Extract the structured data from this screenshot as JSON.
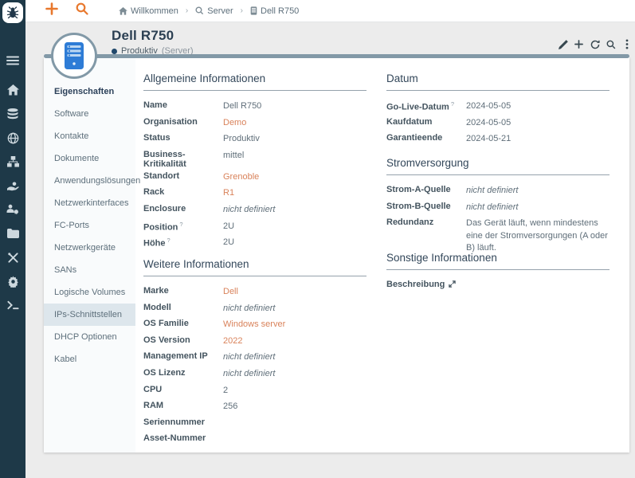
{
  "app": {
    "accent_orange": "#e8782d",
    "link_orange": "#d9825a",
    "sidebar_color": "#1e3948",
    "bar_color": "#8299a7"
  },
  "sidebar": {
    "icons": [
      "bug-logo",
      "hamburger-menu",
      "home",
      "database",
      "globe",
      "sitemap",
      "hand-service",
      "team-settings",
      "folder",
      "tools",
      "gear",
      "terminal"
    ]
  },
  "topbar": {
    "separator": "›",
    "breadcrumb": [
      {
        "label": "Willkommen",
        "icon": "home-icon"
      },
      {
        "label": "Server",
        "icon": "search-icon"
      },
      {
        "label": "Dell R750",
        "icon": "server-icon"
      }
    ]
  },
  "header": {
    "title": "Dell R750",
    "status": "Produktiv",
    "type_label": "(Server)",
    "actions": [
      "edit",
      "add",
      "refresh",
      "search",
      "more"
    ]
  },
  "menu": {
    "items": [
      "Eigenschaften",
      "Software",
      "Kontakte",
      "Dokumente",
      "Anwendungslösungen",
      "Netzwerkinterfaces",
      "FC-Ports",
      "Netzwerkgeräte",
      "SANs",
      "Logische Volumes",
      "IPs-Schnittstellen",
      "DHCP Optionen",
      "Kabel"
    ],
    "active_item": "Eigenschaften",
    "highlighted_item": "IPs-Schnittstellen"
  },
  "sections": {
    "allgemeine": {
      "title": "Allgemeine Informationen",
      "fields": [
        {
          "label": "Name",
          "value": "Dell R750"
        },
        {
          "label": "Organisation",
          "value": "Demo"
        },
        {
          "label": "Status",
          "value": "Produktiv"
        },
        {
          "label": "Business-Kritikalität",
          "value": "mittel"
        },
        {
          "label": "Standort",
          "value": "Grenoble"
        },
        {
          "label": "Rack",
          "value": "R1"
        },
        {
          "label": "Enclosure",
          "value": "nicht definiert"
        },
        {
          "label": "Position",
          "hint": "?",
          "value": "2U"
        },
        {
          "label": "Höhe",
          "hint": "?",
          "value": "2U"
        }
      ]
    },
    "weitere": {
      "title": "Weitere Informationen",
      "fields": [
        {
          "label": "Marke",
          "value": "Dell"
        },
        {
          "label": "Modell",
          "value": "nicht definiert"
        },
        {
          "label": "OS Familie",
          "value": "Windows server"
        },
        {
          "label": "OS Version",
          "value": "2022"
        },
        {
          "label": "Management IP",
          "value": "nicht definiert"
        },
        {
          "label": "OS Lizenz",
          "value": "nicht definiert"
        },
        {
          "label": "CPU",
          "value": "2"
        },
        {
          "label": "RAM",
          "value": "256"
        },
        {
          "label": "Seriennummer",
          "value": ""
        },
        {
          "label": "Asset-Nummer",
          "value": ""
        }
      ]
    },
    "datum": {
      "title": "Datum",
      "fields": [
        {
          "label": "Go-Live-Datum",
          "hint": "?",
          "value": "2024-05-05"
        },
        {
          "label": "Kaufdatum",
          "value": "2024-05-05"
        },
        {
          "label": "Garantieende",
          "value": "2024-05-21"
        }
      ]
    },
    "strom": {
      "title": "Stromversorgung",
      "fields": [
        {
          "label": "Strom-A-Quelle",
          "value": "nicht definiert"
        },
        {
          "label": "Strom-B-Quelle",
          "value": "nicht definiert"
        },
        {
          "label": "Redundanz",
          "value": "Das Gerät läuft, wenn mindestens eine der Stromversorgungen (A oder B) läuft."
        }
      ]
    },
    "sonstige": {
      "title": "Sonstige Informationen",
      "fields": [
        {
          "label": "Beschreibung",
          "value": ""
        }
      ]
    }
  }
}
